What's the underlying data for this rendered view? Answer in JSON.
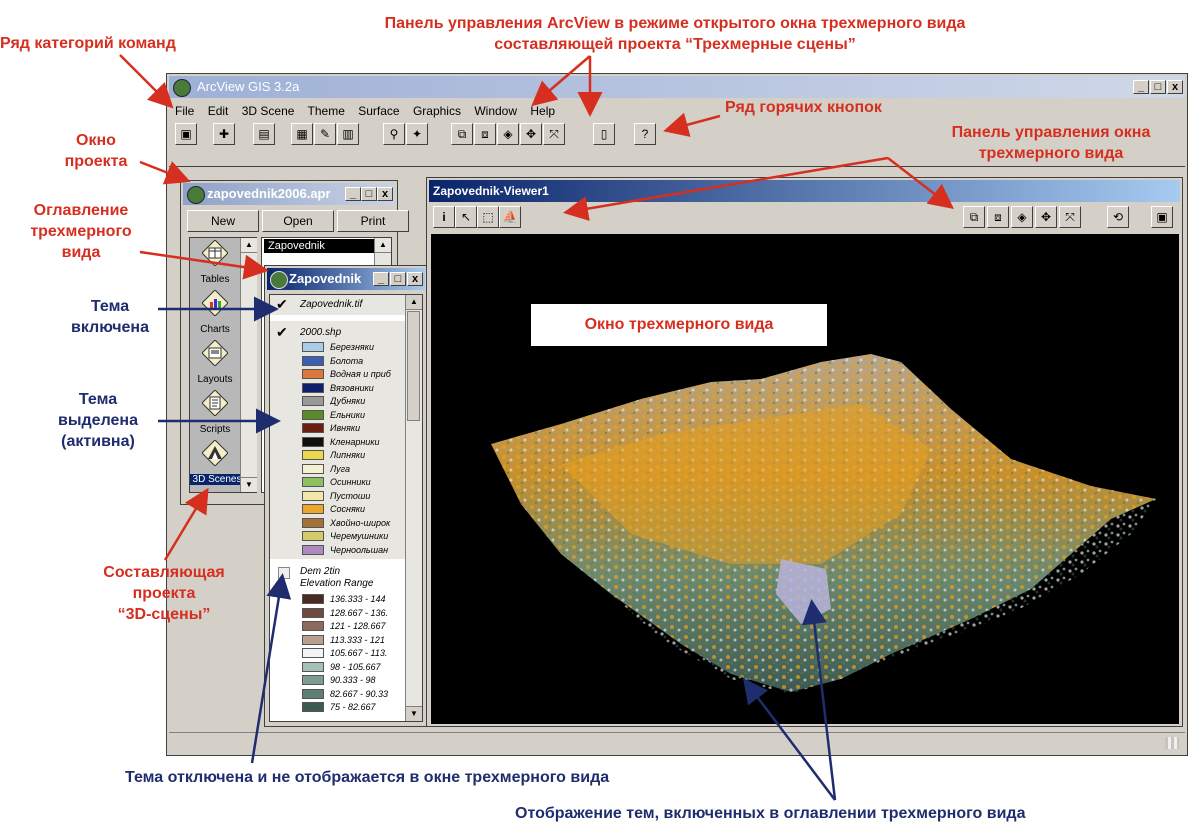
{
  "annotations": {
    "panel_title_line1": "Панель управления ArcView в режиме открытого окна трехмерного вида",
    "panel_title_line2": "составляющей проекта “Трехмерные сцены”",
    "command_categories": "Ряд категорий команд",
    "project_window_line1": "Окно",
    "project_window_line2": "проекта",
    "toc_line1": "Оглавление",
    "toc_line2": "трехмерного",
    "toc_line3": "вида",
    "hotkeys": "Ряд горячих кнопок",
    "viewer_panel_line1": "Панель управления окна",
    "viewer_panel_line2": "трехмерного вида",
    "theme_on_line1": "Тема",
    "theme_on_line2": "включена",
    "theme_active_line1": "Тема",
    "theme_active_line2": "выделена",
    "theme_active_line3": "(активна)",
    "scenes_component_line1": "Составляющая",
    "scenes_component_line2": "проекта",
    "scenes_component_line3": "“3D-сцены”",
    "theme_off": "Тема отключена и не отображается в окне трехмерного вида",
    "themes_display": "Отображение тем, включенных в оглавлении трехмерного вида",
    "viewer_window_label": "Окно трехмерного вида"
  },
  "app": {
    "title": "ArcView GIS 3.2a",
    "menu": [
      "File",
      "Edit",
      "3D Scene",
      "Theme",
      "Surface",
      "Graphics",
      "Window",
      "Help"
    ]
  },
  "project_window": {
    "title": "zapovednik2006.apr",
    "buttons": [
      "New",
      "Open",
      "Print"
    ],
    "items": [
      "Tables",
      "Charts",
      "Layouts",
      "Scripts",
      "3D Scenes"
    ],
    "list_item": "Zapovednik"
  },
  "toc_window": {
    "title": "Zapovednik",
    "theme1": "Zapovednik.tif",
    "theme2": "2000.shp",
    "theme2_classes": [
      {
        "label": "Березняки",
        "color": "#a9cde6"
      },
      {
        "label": "Болота",
        "color": "#3a5fb0"
      },
      {
        "label": "Водная и приб",
        "color": "#d9783a"
      },
      {
        "label": "Вязовники",
        "color": "#0e1f6b"
      },
      {
        "label": "Дубняки",
        "color": "#9a9a9a"
      },
      {
        "label": "Ельники",
        "color": "#5a8a2a"
      },
      {
        "label": "Ивняки",
        "color": "#6b1f12"
      },
      {
        "label": "Кленарники",
        "color": "#101010"
      },
      {
        "label": "Липняки",
        "color": "#e8d84a"
      },
      {
        "label": "Луга",
        "color": "#f4f1d0"
      },
      {
        "label": "Осинники",
        "color": "#8dc061"
      },
      {
        "label": "Пустоши",
        "color": "#f2e6a8"
      },
      {
        "label": "Сосняки",
        "color": "#eda52a"
      },
      {
        "label": "Хвойно-широк",
        "color": "#a5703a"
      },
      {
        "label": "Черемушники",
        "color": "#d4cc6a"
      },
      {
        "label": "Черноольшан",
        "color": "#b088c0"
      }
    ],
    "theme3": "Dem 2tin",
    "theme3_sub": "Elevation Range",
    "theme3_classes": [
      {
        "label": "136.333 - 144",
        "color": "#4a2a22"
      },
      {
        "label": "128.667 - 136.",
        "color": "#6e4a40"
      },
      {
        "label": "121 - 128.667",
        "color": "#8e6a5e"
      },
      {
        "label": "113.333 - 121",
        "color": "#b9a08e"
      },
      {
        "label": "105.667 - 113.",
        "color": "#f4f4f4"
      },
      {
        "label": "98 - 105.667",
        "color": "#a8bfb6"
      },
      {
        "label": "90.333 - 98",
        "color": "#7e9b90"
      },
      {
        "label": "82.667 - 90.33",
        "color": "#5f7e74"
      },
      {
        "label": "75 - 82.667",
        "color": "#3f5a50"
      }
    ]
  },
  "viewer_window": {
    "title": "Zapovednik-Viewer1"
  },
  "colors": {
    "accent_red": "#d62f20",
    "accent_blue": "#1f2d6e",
    "window_face": "#d4d0c8",
    "title_active": "#0a246a",
    "scene_bg": "#000000"
  }
}
